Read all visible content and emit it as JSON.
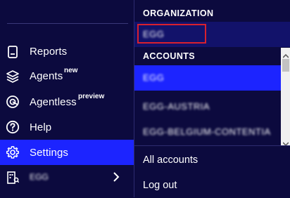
{
  "nav": {
    "items": [
      {
        "label": "Reports",
        "icon": "reports-icon"
      },
      {
        "label": "Agents",
        "badge": "new",
        "icon": "layers-icon"
      },
      {
        "label": "Agentless",
        "badge": "preview",
        "icon": "agentless-icon"
      },
      {
        "label": "Help",
        "icon": "help-icon"
      },
      {
        "label": "Settings",
        "icon": "gear-icon",
        "active": true
      },
      {
        "label": "EGG",
        "icon": "org-icon",
        "blurred": true
      }
    ]
  },
  "dropdown": {
    "organization_header": "ORGANIZATION",
    "organization_value": "EGG",
    "accounts_header": "ACCOUNTS",
    "accounts": [
      "EGG",
      "EGG-AUSTRIA",
      "EGG-BELGIUM-CONTENTIA"
    ],
    "all_accounts_label": "All accounts",
    "logout_label": "Log out"
  },
  "colors": {
    "background": "#0c0a3e",
    "accent": "#1c24ff",
    "highlight_border": "#d8202e"
  }
}
